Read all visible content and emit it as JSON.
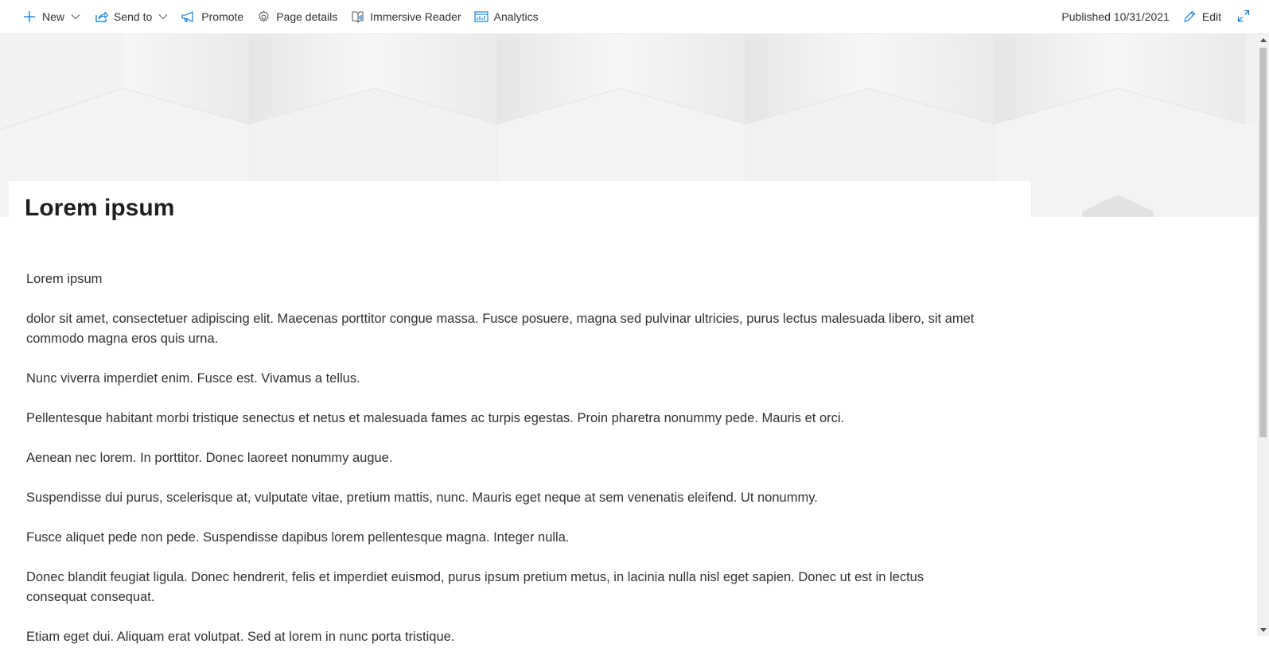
{
  "commandbar": {
    "items": [
      {
        "label": "New",
        "icon": "plus-icon",
        "has_dropdown": true
      },
      {
        "label": "Send to",
        "icon": "share-icon",
        "has_dropdown": true
      },
      {
        "label": "Promote",
        "icon": "megaphone-icon",
        "has_dropdown": false
      },
      {
        "label": "Page details",
        "icon": "gear-icon",
        "has_dropdown": false
      },
      {
        "label": "Immersive Reader",
        "icon": "immersive-reader-icon",
        "has_dropdown": false
      },
      {
        "label": "Analytics",
        "icon": "analytics-icon",
        "has_dropdown": false
      }
    ],
    "published": "Published 10/31/2021",
    "edit_label": "Edit",
    "accent_color": "#0078d4"
  },
  "page": {
    "title": "Lorem ipsum",
    "paragraphs": [
      "Lorem ipsum",
      "dolor sit amet, consectetuer adipiscing elit. Maecenas porttitor congue massa. Fusce posuere, magna sed pulvinar ultricies, purus lectus malesuada libero, sit amet commodo magna eros quis urna.",
      "Nunc viverra imperdiet enim. Fusce est. Vivamus a tellus.",
      "Pellentesque habitant morbi tristique senectus et netus et malesuada fames ac turpis egestas. Proin pharetra nonummy pede. Mauris et orci.",
      "Aenean nec lorem. In porttitor. Donec laoreet nonummy augue.",
      "Suspendisse dui purus, scelerisque at, vulputate vitae, pretium mattis, nunc. Mauris eget neque at sem venenatis eleifend. Ut nonummy.",
      "Fusce aliquet pede non pede. Suspendisse dapibus lorem pellentesque magna. Integer nulla.",
      "Donec blandit feugiat ligula. Donec hendrerit, felis et imperdiet euismod, purus ipsum pretium metus, in lacinia nulla nisl eget sapien. Donec ut est in lectus consequat consequat.",
      "Etiam eget dui. Aliquam erat volutpat. Sed at lorem in nunc porta tristique."
    ]
  }
}
